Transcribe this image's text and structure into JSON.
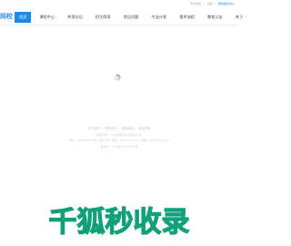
{
  "topbar": {
    "links": [
      "学生登录",
      "|",
      "注册",
      "|"
    ],
    "accent_link": "我的报名中心"
  },
  "logo": {
    "text": "网校"
  },
  "nav": {
    "items": [
      "首页",
      "课程中心",
      "师资队伍",
      "招生简章",
      "常见问题",
      "专业计划",
      "报考流程",
      "教育公告",
      "关于"
    ],
    "active_index": 0,
    "active_color": "#1e88e5"
  },
  "loading": {
    "icon": "spinner-icon"
  },
  "footer": {
    "links": [
      "关于我们",
      "联系我们",
      "网站地图",
      "免责声明"
    ],
    "line1": "版权所有：XX科技教育培训有限公司",
    "line2": "地址：XX省XX市XX区XX路XX号 · 电话：400-XXX-XXXX · 邮箱：XXX@XXX.com",
    "line3": "备案号：XICP备XXXXXXXX号"
  },
  "watermark": {
    "text": "千狐秒收录",
    "color": "#11a07a"
  }
}
